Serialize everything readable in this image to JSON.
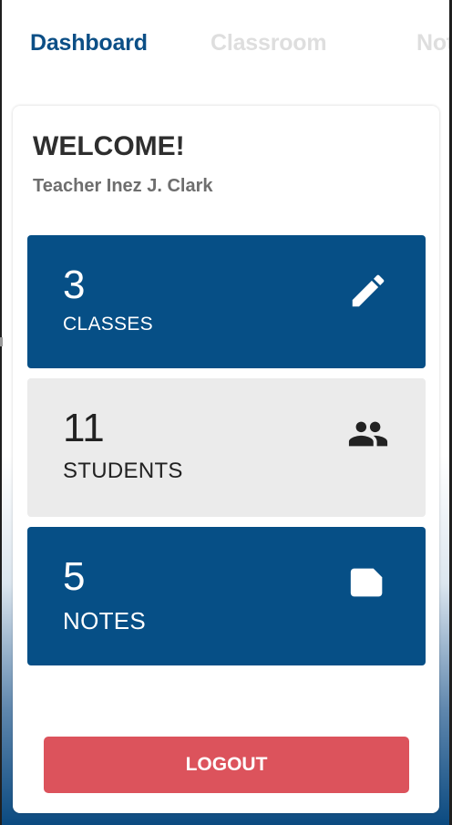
{
  "tabs": [
    {
      "label": "Dashboard",
      "active": true
    },
    {
      "label": "Classroom",
      "active": false
    },
    {
      "label": "Notes",
      "active": false
    }
  ],
  "welcome": {
    "title": "WELCOME!",
    "subtitle": "Teacher Inez J. Clark"
  },
  "stats": [
    {
      "count": "3",
      "label": "CLASSES",
      "icon": "pencil-icon",
      "style": "blue"
    },
    {
      "count": "11",
      "label": "STUDENTS",
      "icon": "people-icon",
      "style": "grey"
    },
    {
      "count": "5",
      "label": "NOTES",
      "icon": "note-icon",
      "style": "blue"
    }
  ],
  "logout_label": "LOGOUT",
  "colors": {
    "primary": "#064f86",
    "tab_active": "#0c4f86",
    "tab_inactive": "#dedede",
    "logout": "#dc535c",
    "stat_grey": "#ebebeb"
  }
}
